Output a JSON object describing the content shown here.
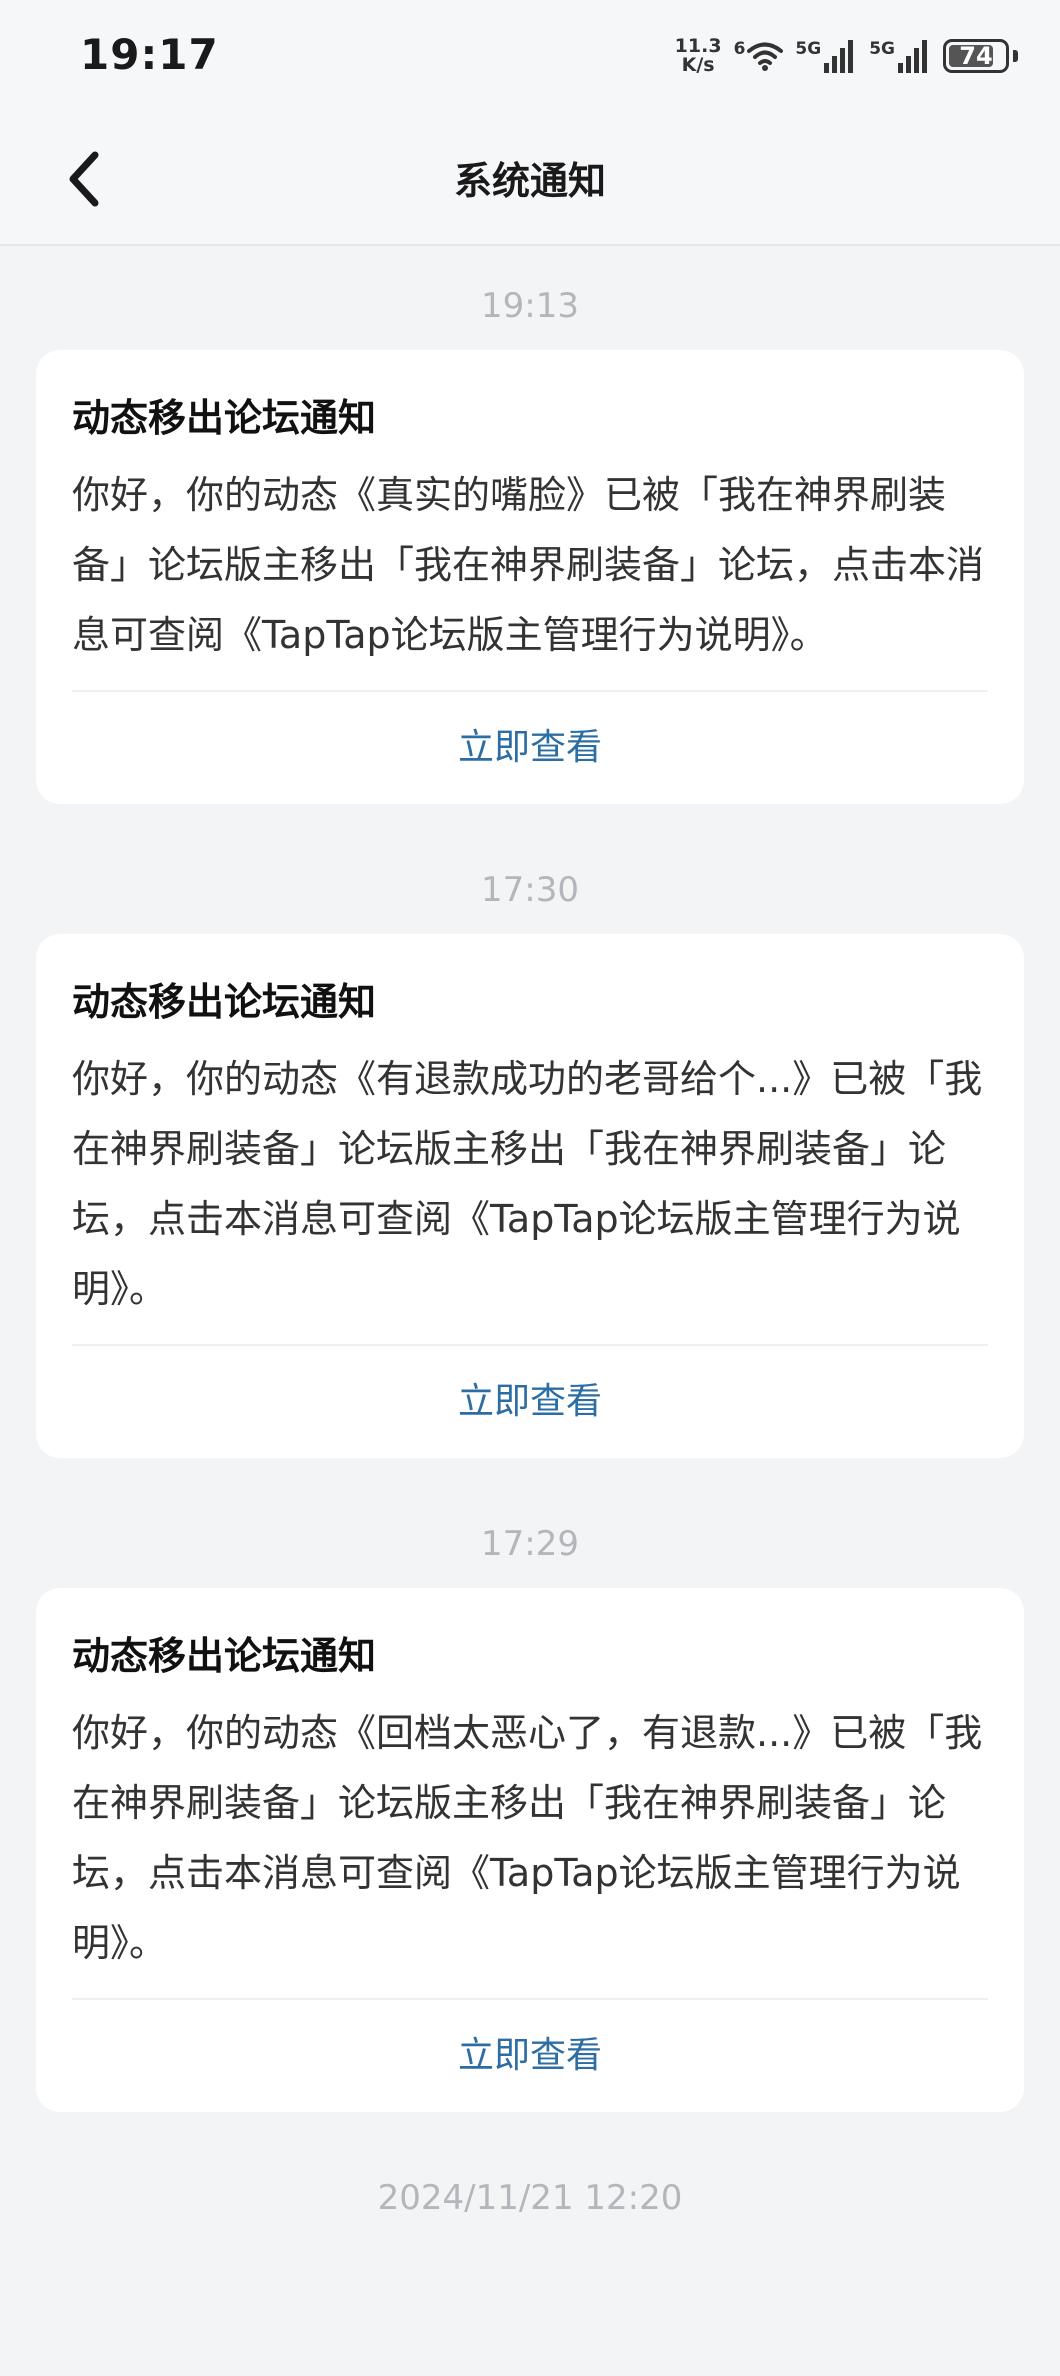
{
  "status_bar": {
    "time": "19:17",
    "net_speed_value": "11.3",
    "net_speed_unit": "K/s",
    "wifi_badge": "6",
    "sim1": "5G",
    "sim2": "5G",
    "battery": "74"
  },
  "header": {
    "title": "系统通知"
  },
  "notifications": [
    {
      "time": "19:13",
      "title": "动态移出论坛通知",
      "body": "你好，你的动态《真实的嘴脸》已被「我在神界刷装备」论坛版主移出「我在神界刷装备」论坛，点击本消息可查阅《TapTap论坛版主管理行为说明》。",
      "action": "立即查看"
    },
    {
      "time": "17:30",
      "title": "动态移出论坛通知",
      "body": "你好，你的动态《有退款成功的老哥给个...》已被「我在神界刷装备」论坛版主移出「我在神界刷装备」论坛，点击本消息可查阅《TapTap论坛版主管理行为说明》。",
      "action": "立即查看"
    },
    {
      "time": "17:29",
      "title": "动态移出论坛通知",
      "body": "你好，你的动态《回档太恶心了，有退款...》已被「我在神界刷装备」论坛版主移出「我在神界刷装备」论坛，点击本消息可查阅《TapTap论坛版主管理行为说明》。",
      "action": "立即查看"
    }
  ],
  "last_timestamp": "2024/11/21  12:20",
  "colors": {
    "background": "#f3f4f6",
    "card": "#ffffff",
    "link": "#2c6da3",
    "timestamp": "#b3b6bb"
  }
}
